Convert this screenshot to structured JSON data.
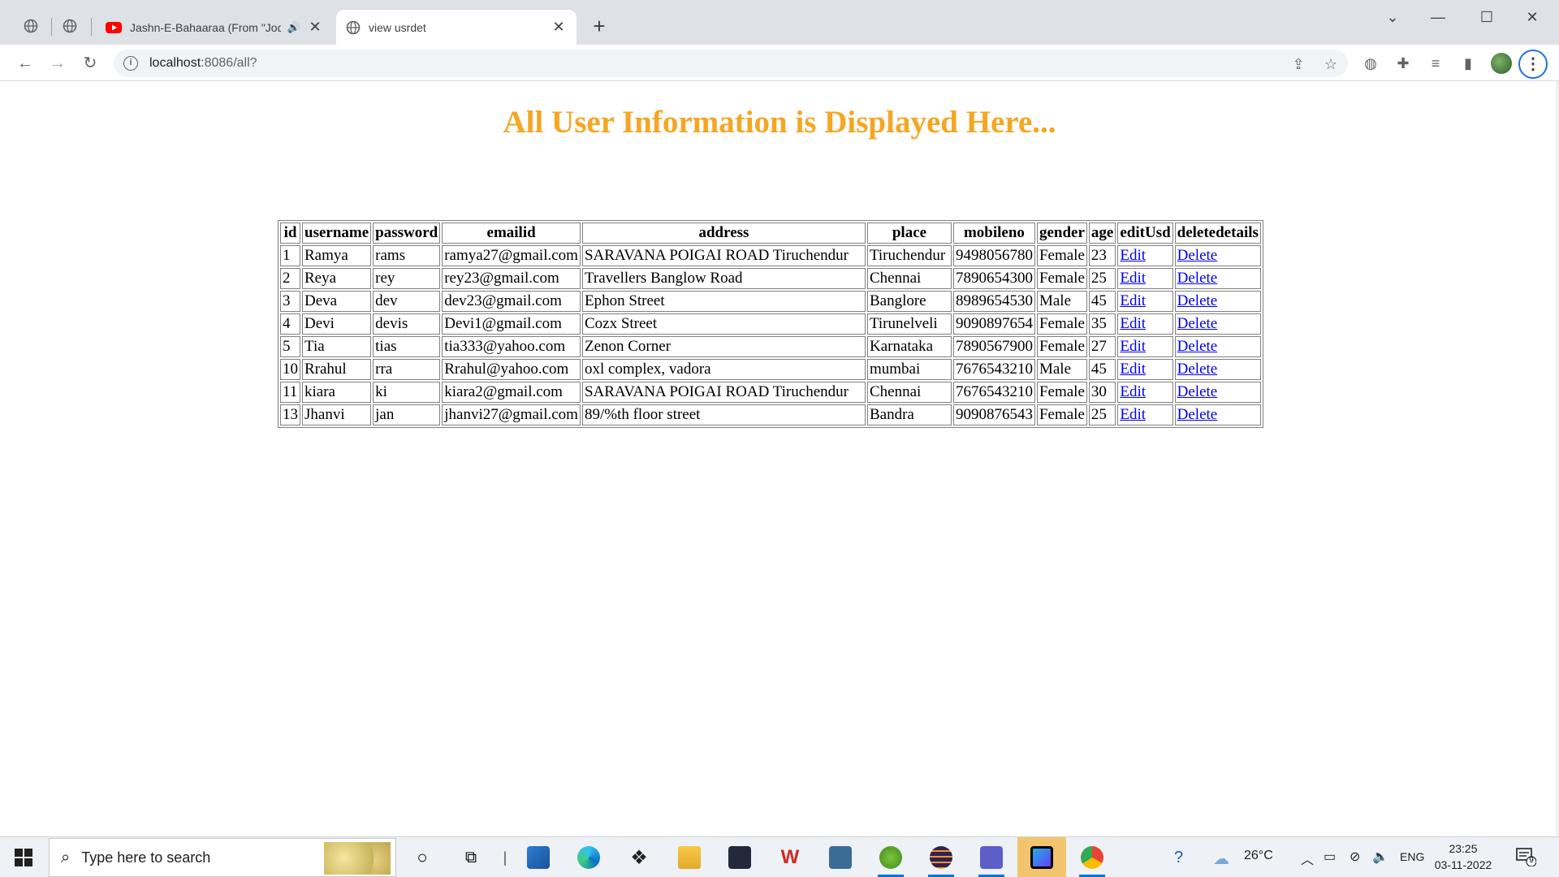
{
  "browser": {
    "tabs": [
      {
        "title": "Jashn-E-Bahaaraa (From \"Jodhaa Akbar\")",
        "icon": "youtube-icon",
        "audio": "speaker-icon"
      },
      {
        "title": "view usrdet",
        "icon": "globe-icon"
      }
    ],
    "url": {
      "host": "localhost",
      "rest": ":8086/all?"
    },
    "new_tab_symbol": "+",
    "close_symbol": "✕"
  },
  "page": {
    "heading": "All User Information is Displayed Here...",
    "heading_color": "#f5a623",
    "columns": [
      "id",
      "username",
      "password",
      "emailid",
      "address",
      "place",
      "mobileno",
      "gender",
      "age",
      "editUsd",
      "deletedetails"
    ],
    "rows": [
      {
        "id": "1",
        "username": "Ramya",
        "password": "rams",
        "emailid": "ramya27@gmail.com",
        "address": "SARAVANA POIGAI ROAD Tiruchendur",
        "place": "Tiruchendur",
        "mobileno": "9498056780",
        "gender": "Female",
        "age": "23",
        "edit": "Edit",
        "delete": "Delete"
      },
      {
        "id": "2",
        "username": "Reya",
        "password": "rey",
        "emailid": "rey23@gmail.com",
        "address": "Travellers Banglow Road",
        "place": "Chennai",
        "mobileno": "7890654300",
        "gender": "Female",
        "age": "25",
        "edit": "Edit",
        "delete": "Delete"
      },
      {
        "id": "3",
        "username": "Deva",
        "password": "dev",
        "emailid": "dev23@gmail.com",
        "address": "Ephon Street",
        "place": "Banglore",
        "mobileno": "8989654530",
        "gender": "Male",
        "age": "45",
        "edit": "Edit",
        "delete": "Delete"
      },
      {
        "id": "4",
        "username": "Devi",
        "password": "devis",
        "emailid": "Devi1@gmail.com",
        "address": "Cozx Street",
        "place": "Tirunelveli",
        "mobileno": "9090897654",
        "gender": "Female",
        "age": "35",
        "edit": "Edit",
        "delete": "Delete"
      },
      {
        "id": "5",
        "username": "Tia",
        "password": "tias",
        "emailid": "tia333@yahoo.com",
        "address": "Zenon Corner",
        "place": "Karnataka",
        "mobileno": "7890567900",
        "gender": "Female",
        "age": "27",
        "edit": "Edit",
        "delete": "Delete"
      },
      {
        "id": "10",
        "username": "Rrahul",
        "password": "rra",
        "emailid": "Rrahul@yahoo.com",
        "address": "oxl complex, vadora",
        "place": "mumbai",
        "mobileno": "7676543210",
        "gender": "Male",
        "age": "45",
        "edit": "Edit",
        "delete": "Delete"
      },
      {
        "id": "11",
        "username": "kiara",
        "password": "ki",
        "emailid": "kiara2@gmail.com",
        "address": "SARAVANA POIGAI ROAD Tiruchendur",
        "place": "Chennai",
        "mobileno": "7676543210",
        "gender": "Female",
        "age": "30",
        "edit": "Edit",
        "delete": "Delete"
      },
      {
        "id": "13",
        "username": "Jhanvi",
        "password": "jan",
        "emailid": "jhanvi27@gmail.com",
        "address": "89/%th floor street",
        "place": "Bandra",
        "mobileno": "9090876543",
        "gender": "Female",
        "age": "25",
        "edit": "Edit",
        "delete": "Delete"
      }
    ]
  },
  "taskbar": {
    "search_placeholder": "Type here to search",
    "weather": "26°C",
    "language": "ENG",
    "time": "23:25",
    "date": "03-11-2022",
    "notification_count": "9"
  }
}
